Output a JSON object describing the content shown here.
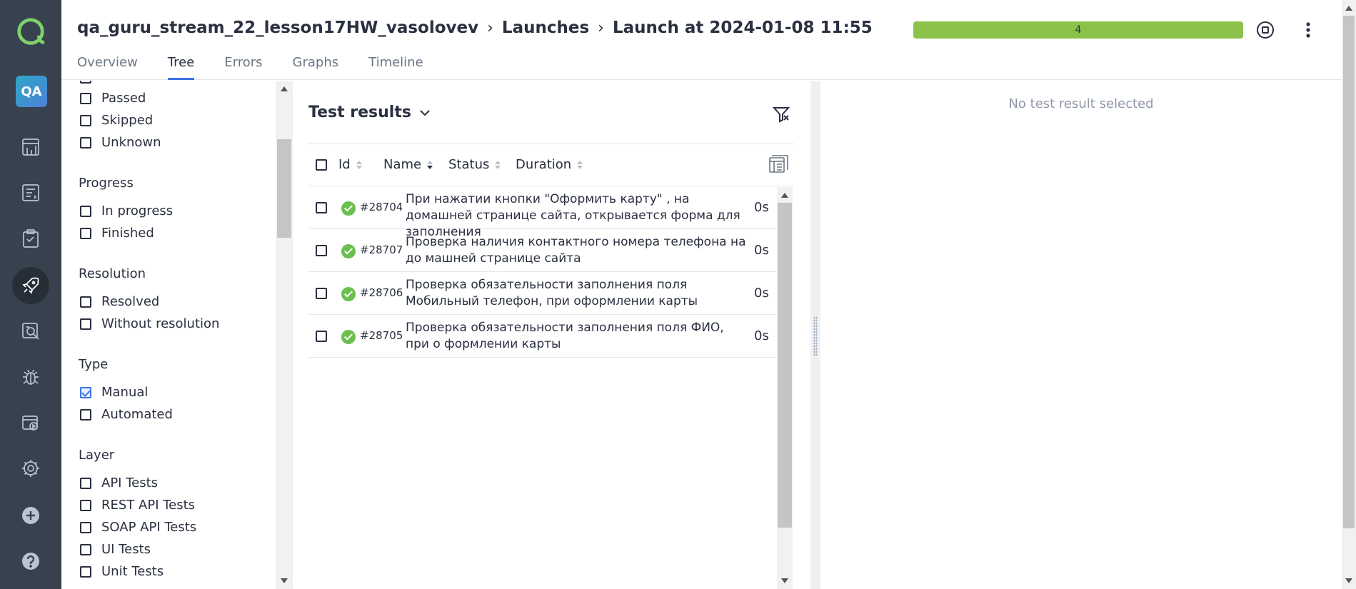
{
  "nav": {
    "logo_icon": "allure-logo-icon",
    "project_avatar": "QA",
    "items": [
      {
        "icon": "dashboard-icon"
      },
      {
        "icon": "test-cases-icon"
      },
      {
        "icon": "test-plans-icon"
      },
      {
        "icon": "launches-icon",
        "active": true
      },
      {
        "icon": "analytics-icon"
      },
      {
        "icon": "defects-icon"
      },
      {
        "icon": "jobs-icon"
      },
      {
        "icon": "settings-icon"
      },
      {
        "icon": "add-icon"
      },
      {
        "icon": "help-icon"
      }
    ]
  },
  "header": {
    "breadcrumbs": {
      "project": "qa_guru_stream_22_lesson17HW_vasolovev",
      "section": "Launches",
      "launch": "Launch at 2024-01-08 11:55"
    },
    "progress_count": "4",
    "progress_passed_fraction": 1.0,
    "progress_color": "#8bc34a",
    "tabs": [
      {
        "label": "Overview"
      },
      {
        "label": "Tree",
        "active": true
      },
      {
        "label": "Errors"
      },
      {
        "label": "Graphs"
      },
      {
        "label": "Timeline"
      }
    ]
  },
  "filters": {
    "status_options": [
      "Passed",
      "Skipped",
      "Unknown"
    ],
    "progress": {
      "title": "Progress",
      "options": [
        "In progress",
        "Finished"
      ]
    },
    "resolution": {
      "title": "Resolution",
      "options": [
        "Resolved",
        "Without resolution"
      ]
    },
    "type": {
      "title": "Type",
      "options": [
        {
          "label": "Manual",
          "checked": true
        },
        {
          "label": "Automated",
          "checked": false
        }
      ]
    },
    "layer": {
      "title": "Layer",
      "options": [
        "API Tests",
        "REST API Tests",
        "SOAP API Tests",
        "UI Tests",
        "Unit Tests"
      ]
    }
  },
  "results": {
    "title": "Test results",
    "columns": {
      "id": "Id",
      "name": "Name",
      "status": "Status",
      "duration": "Duration"
    },
    "rows": [
      {
        "id": "#28704",
        "name": "При нажатии кнопки \"Оформить карту\" , на домашней странице сайта, открывается форма для заполнения",
        "duration": "0s",
        "status": "passed"
      },
      {
        "id": "#28707",
        "name": "Проверка наличия контактного номера телефона на до машней странице сайта",
        "duration": "0s",
        "status": "passed"
      },
      {
        "id": "#28706",
        "name": "Проверка обязательности заполнения поля Мобильный телефон, при оформлении карты",
        "duration": "0s",
        "status": "passed"
      },
      {
        "id": "#28705",
        "name": "Проверка обязательности заполнения поля ФИО, при о формлении карты",
        "duration": "0s",
        "status": "passed"
      }
    ]
  },
  "detail": {
    "empty_text": "No test result selected"
  },
  "colors": {
    "rail_bg": "#38424e",
    "accent": "#3d72e4",
    "passed": "#6bbf4e"
  }
}
